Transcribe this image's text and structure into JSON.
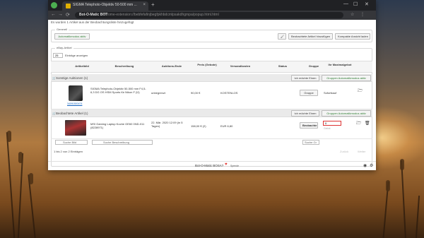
{
  "browser": {
    "tab_title": "SIGMA Telephoto-Objektiv 50-500 mm ...",
    "url_host": "Bot-O-Matic BOT",
    "url_path": "chrome-extension://bebfefafinjbegfpkhbdcmlpsakdhgmpa/popup.html.html",
    "tab_close": "×",
    "new_tab": "+",
    "nav_back": "←",
    "nav_forward": "→",
    "nav_reload": "⟳",
    "window_min": "—",
    "window_max": "☐",
    "window_close": "✕"
  },
  "notice": "Es wurden 1 Artikel aus der Beobachtungsliste hinzugefügt",
  "general": {
    "legend": "Generell",
    "auto_mode_btn": "Automatikmodus aktiv",
    "add_watched_btn": "Beobachtete Artikel hinzufügen",
    "compact_view_btn": "Kompakte Ansicht laden"
  },
  "ebay": {
    "legend": "eBay-Artikel",
    "page_size": "25",
    "page_size_label": "Einträge anzeigen",
    "columns": [
      "",
      "Artikelbild",
      "Beschreibung",
      "Auktions-Ende",
      "Preis (Gebote)",
      "Versandkosten",
      "Status",
      "Gruppe",
      "Ihr Maximalgebot",
      "",
      ""
    ],
    "groups": [
      {
        "label": "Sonstige Auktionen (1)",
        "snipe_btn": "Ich möchte Einen",
        "auto_btn": "Gruppen Automatikmodus aktiv",
        "items": [
          {
            "img_caption": "34091500474",
            "description": "SIGMA Telephoto-Objektiv 50-500 mm F4,5-6,3 DG OS HSM Sports für Nikon F (Ü)",
            "end": "unbegrenzt",
            "price": "90,00 €",
            "shipping": "KOSTENLOS",
            "status": "",
            "group": "Gruppe",
            "bid": "",
            "bid_note": "Sofortkauf"
          }
        ]
      },
      {
        "label": "Beobachtete Artikel (1)",
        "snipe_btn": "Ich möchte Einen",
        "auto_btn": "Gruppen Automatikmodus aktiv",
        "items": [
          {
            "img_caption": "",
            "description": "MSI Gaming Laptop Koche GE60 0ND-011 (8228971)",
            "end": "22. Mär. 2020 12:09 (in 5 Tagen)",
            "price": "158,00 € (2)",
            "shipping": "EUR 6,80",
            "status": "",
            "group": "Beobachte",
            "bid": "0",
            "bid_note": "Gebot"
          }
        ]
      }
    ],
    "search_image": "Suche Bild",
    "search_desc": "Suche Beschreibung",
    "search_group": "Suche Gr",
    "info": "1 bis 2 von 2 Einträgen",
    "prev": "Zurück",
    "next": "Weiter"
  },
  "footer": {
    "text": "Bot-O-Matic BOSA?",
    "spende": "Spende"
  },
  "colors": {
    "accent": "#2e7d32",
    "danger": "#e53935"
  }
}
